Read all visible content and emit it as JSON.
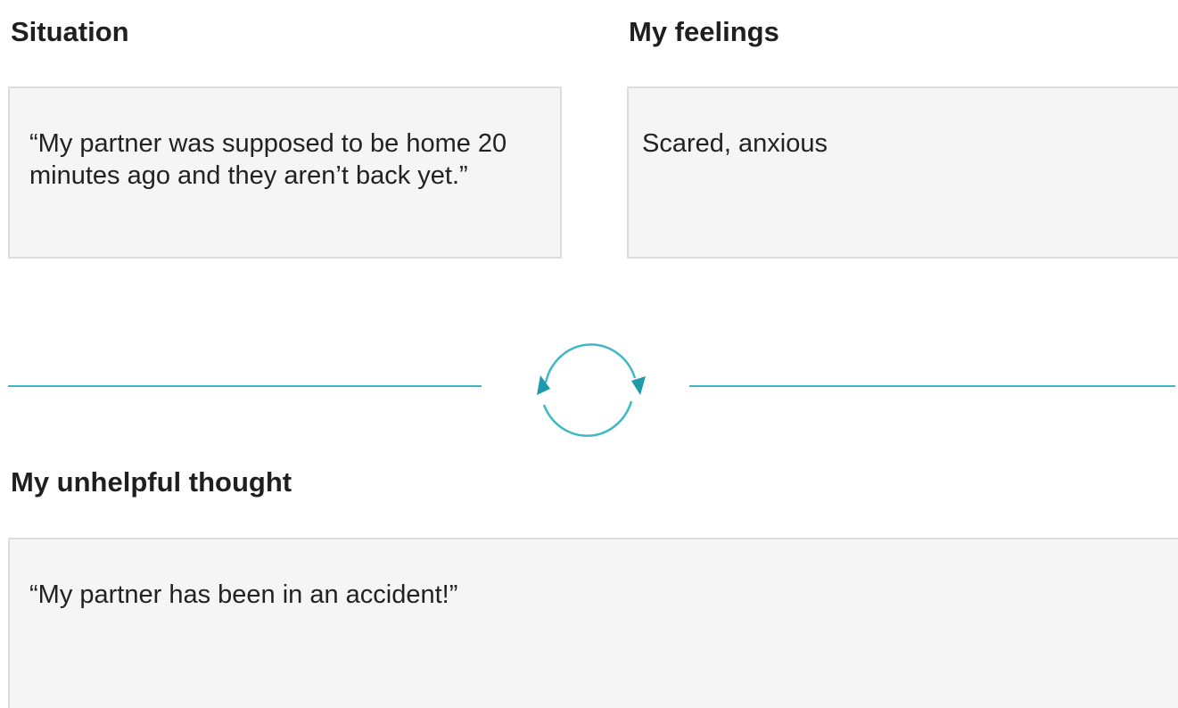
{
  "situation": {
    "heading": "Situation",
    "text": "“My partner was supposed to be home 20 minutes ago and they aren’t back yet.”"
  },
  "feelings": {
    "heading": "My feelings",
    "text": "Scared, anxious"
  },
  "thought": {
    "heading": "My unhelpful thought",
    "text": "“My partner has been in an accident!”"
  },
  "colors": {
    "accent": "#3fb8c4",
    "arrow": "#1e9aa8",
    "box_background": "#f5f5f5",
    "box_border": "#dcdcdc"
  },
  "icons": {
    "cycle": "cycle-arrows-icon"
  }
}
